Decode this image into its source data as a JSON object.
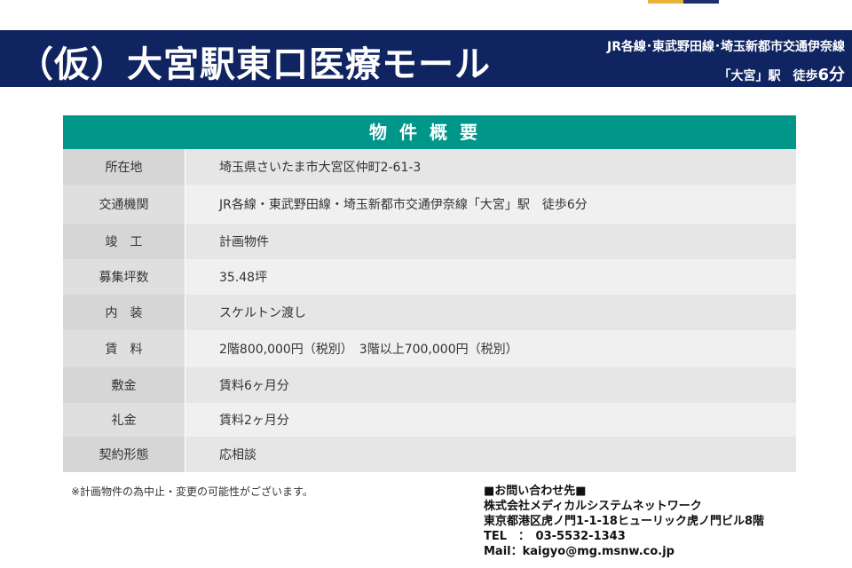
{
  "header": {
    "title": "（仮）大宮駅東口医療モール",
    "lines": "JR各線･東武野田線･埼玉新都市交通伊奈線",
    "station": "「大宮」駅　徒歩",
    "walk_minutes": "6分"
  },
  "table": {
    "title": "物件概要",
    "rows": [
      {
        "label": "所在地",
        "value": "埼玉県さいたま市大宮区仲町2-61-3"
      },
      {
        "label": "交通機関",
        "value": "JR各線・東武野田線・埼玉新都市交通伊奈線「大宮」駅　徒歩6分"
      },
      {
        "label": "竣　工",
        "value": "計画物件"
      },
      {
        "label": "募集坪数",
        "value": "35.48坪"
      },
      {
        "label": "内　装",
        "value": "スケルトン渡し"
      },
      {
        "label": "賃　料",
        "value": "2階800,000円（税別）　3階以上700,000円（税別）"
      },
      {
        "label": "敷金",
        "value": "賃料6ヶ月分"
      },
      {
        "label": "礼金",
        "value": "賃料2ヶ月分"
      },
      {
        "label": "契約形態",
        "value": "応相談"
      }
    ]
  },
  "note": "※計画物件の為中止・変更の可能性がございます。",
  "contact": {
    "heading": "■お問い合わせ先■",
    "company": "株式会社メディカルシステムネットワーク",
    "address": "東京都港区虎ノ門1-1-18ヒューリック虎ノ門ビル8階",
    "tel": "TEL　：　03-5532-1343",
    "mail_label": "Mail：",
    "mail": "kaigyo@mg.msnw.co.jp"
  },
  "colors": {
    "header_bg": "#0f2461",
    "table_title_bg": "#00968a",
    "accent_gold": "#e8b13a"
  }
}
